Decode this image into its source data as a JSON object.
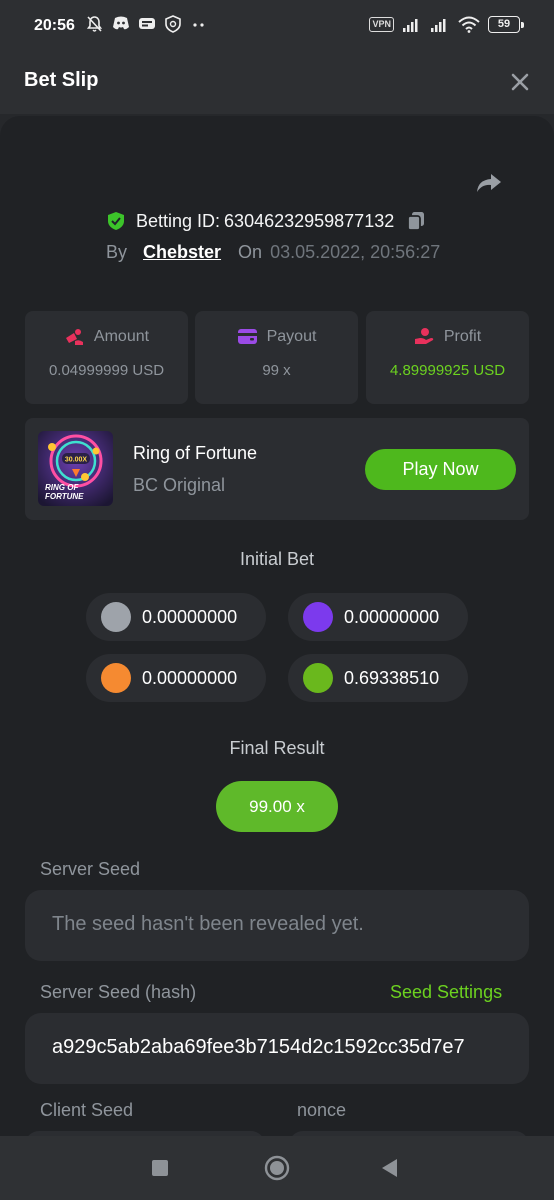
{
  "status": {
    "time": "20:56",
    "vpn": "VPN",
    "battery": "59"
  },
  "header": {
    "title": "Bet Slip"
  },
  "bet": {
    "id_label": "Betting ID:",
    "id_value": "63046232959877132",
    "by_label": "By",
    "user": "Chebster",
    "on_label": "On",
    "date": "03.05.2022, 20:56:27"
  },
  "stats": {
    "amount_label": "Amount",
    "amount_value": "0.04999999 USD",
    "payout_label": "Payout",
    "payout_value": "99 x",
    "profit_label": "Profit",
    "profit_value": "4.89999925 USD"
  },
  "game": {
    "name": "Ring of Fortune",
    "provider": "BC Original",
    "play_label": "Play Now",
    "thumb_multiplier": "30.00X",
    "thumb_title_line1": "RING OF",
    "thumb_title_line2": "FORTUNE"
  },
  "initial_bet": {
    "title": "Initial Bet",
    "coins": [
      {
        "color": "gray",
        "value": "0.00000000"
      },
      {
        "color": "purple",
        "value": "0.00000000"
      },
      {
        "color": "orange",
        "value": "0.00000000"
      },
      {
        "color": "green",
        "value": "0.69338510"
      }
    ]
  },
  "final_result": {
    "title": "Final Result",
    "value": "99.00 x"
  },
  "seeds": {
    "server_seed_label": "Server Seed",
    "server_seed_value": "The seed hasn't been revealed yet.",
    "server_hash_label": "Server Seed (hash)",
    "seed_settings_label": "Seed Settings",
    "server_hash_value": "a929c5ab2aba69fee3b7154d2c1592cc35d7e7",
    "client_seed_label": "Client Seed",
    "nonce_label": "nonce"
  },
  "colors": {
    "accent_green": "#6cd220",
    "button_green": "#4eb81d",
    "coin_gray": "#9ea3aa",
    "coin_purple": "#7c3aed",
    "coin_orange": "#f58a31",
    "coin_green": "#6ab81d"
  }
}
